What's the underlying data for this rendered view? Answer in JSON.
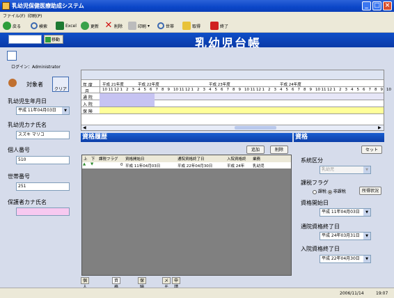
{
  "window": {
    "title": "乳幼児保健医療助成システム"
  },
  "menu": [
    "ファイル(F)",
    "印刷(P)"
  ],
  "toolbar": {
    "back": "戻る",
    "search": "検索",
    "excel": "Excel",
    "refresh": "更新",
    "delete": "削除",
    "print": "印刷",
    "household": "世帯",
    "fetch": "取得",
    "exit": "終了"
  },
  "header": {
    "move_button": "移動",
    "title": "乳幼児台帳"
  },
  "left": {
    "login": "ログイン：Administrator",
    "target_label": "対象者",
    "clear_button": "クリア",
    "birth_label": "乳幼児生年月日",
    "birth_value": "平成 11年04月03日",
    "kana_label": "乳幼児カナ氏名",
    "kana_value": "スズキ マリコ",
    "personal_label": "個人番号",
    "personal_value": "510",
    "household_label": "世帯番号",
    "household_value": "251",
    "guardian_label": "保護者カナ氏名",
    "guardian_value": ""
  },
  "timeline": {
    "row_year": "年 度",
    "row_month": "月",
    "row_visit": "通 院",
    "row_inpatient": "入 院",
    "row_insurance": "保 険",
    "years": [
      "平成 21年度",
      "平成 22年度",
      "平成 23年度",
      "平成 24年度"
    ],
    "months": [
      "10",
      "11",
      "12",
      "1",
      "2",
      "3",
      "4",
      "5",
      "6",
      "7",
      "8",
      "9",
      "10",
      "11",
      "12",
      "1",
      "2",
      "3",
      "4",
      "5",
      "6",
      "7",
      "8",
      "9",
      "10",
      "11",
      "12",
      "1",
      "2",
      "3",
      "4",
      "5",
      "6",
      "7",
      "8",
      "9",
      "10",
      "11",
      "12",
      "1",
      "2",
      "3",
      "4",
      "5",
      "6",
      "7",
      "8",
      "9",
      "10"
    ]
  },
  "history": {
    "title": "資格履歴",
    "add_button": "追加",
    "delete_button": "削除",
    "columns": [
      "上",
      "下",
      "課税フラグ",
      "資格開始日",
      "通院資格終了日",
      "入院資格終",
      "業務"
    ],
    "rows": [
      {
        "flag": "0",
        "start": "平成 11年04月03日",
        "visit_end": "平成 22年04月30日",
        "inpat_end": "平成 24年",
        "work": "乳幼児"
      }
    ]
  },
  "qual": {
    "title": "資格",
    "set_button": "セット",
    "system_label": "系統区分",
    "system_value": "乳幼児",
    "tax_label": "課税フラグ",
    "tax_opt1": "課税",
    "tax_opt2": "非課税",
    "income_button": "所得状況",
    "start_label": "資格開始日",
    "start_value": "平成 11年04月03日",
    "visit_end_label": "通院資格終了日",
    "visit_end_value": "平成 24年03月31日",
    "inpat_end_label": "入院資格終了日",
    "inpat_end_value": "平成 22年04月30日"
  },
  "tabs": [
    "個人情報管理",
    "資格管理",
    "保険管理",
    "メモ",
    "申請情報"
  ],
  "status": {
    "date": "2006/11/14",
    "time": "19:07"
  },
  "colors": {
    "title_bar": "#0b46c8",
    "panel": "#d6dceb",
    "visit_fill": "#c6c3f2",
    "insurance_fill": "#ffff9a"
  }
}
